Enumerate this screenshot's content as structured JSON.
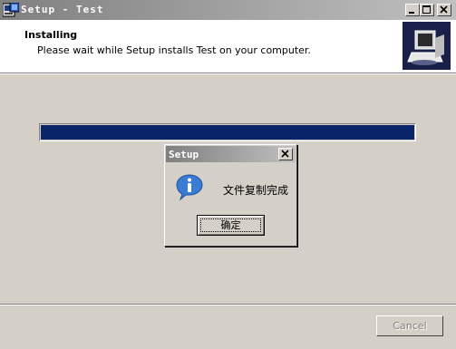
{
  "window": {
    "title": "Setup - Test",
    "app_icon": "setup-app-icon",
    "controls": [
      "minimize-icon",
      "maximize-icon",
      "close-icon"
    ]
  },
  "header": {
    "title": "Installing",
    "subtitle": "Please wait while Setup installs Test on your computer.",
    "logo": "installer-computer-logo"
  },
  "progress": {
    "value": 1.0
  },
  "footer": {
    "cancel_label": "Cancel",
    "cancel_enabled": false
  },
  "dialog": {
    "title": "Setup",
    "message": "文件复制完成",
    "icon": "info-icon",
    "ok_label": "确定"
  },
  "colors": {
    "title_bar_inactive": "#808080",
    "window_bg": "#d4d0c8",
    "progress_fill": "#0a246a",
    "logo_bg": "#1a1f4a"
  }
}
